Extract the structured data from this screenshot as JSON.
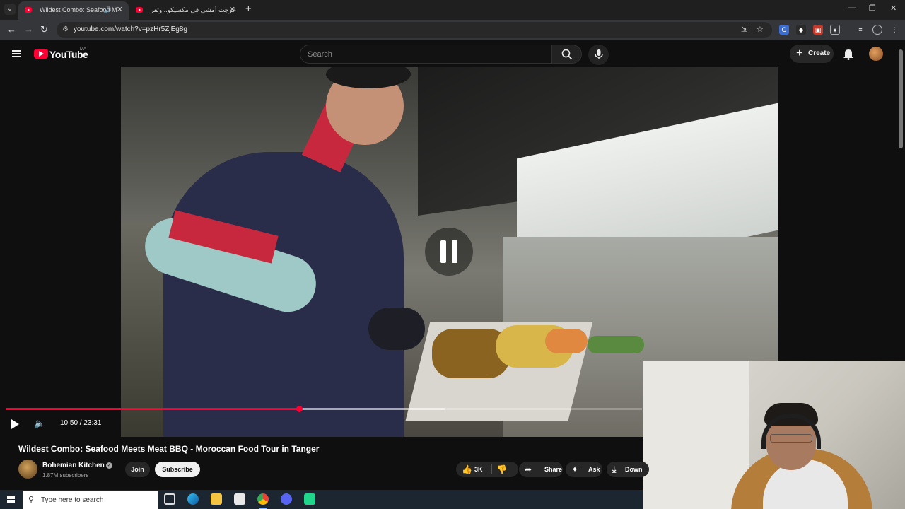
{
  "browser": {
    "tabs": [
      {
        "title": "Wildest Combo: Seafood M",
        "active": true,
        "audio": true
      },
      {
        "title": "خرجت أمشي في مكسيكو.. وتعر",
        "active": false
      }
    ],
    "new_tab_label": "+",
    "url": "youtube.com/watch?v=pzHr5ZjEg8g",
    "accent_color": "#ff0033"
  },
  "youtube": {
    "logo_text": "YouTube",
    "country_code": "MA",
    "search_placeholder": "Search",
    "create_label": "Create"
  },
  "player": {
    "current_time": "10:50",
    "duration": "23:31",
    "time_display": "10:50 / 23:31",
    "progress": 0.4606,
    "buffered": 0.69,
    "state": "paused-indicator"
  },
  "video": {
    "title": "Wildest Combo: Seafood Meets Meat BBQ - Moroccan Food Tour in Tanger",
    "channel_name": "Bohemian Kitchen",
    "subscribers": "1.87M subscribers",
    "join_label": "Join",
    "subscribe_label": "Subscribe",
    "likes": "3K",
    "share_label": "Share",
    "ask_label": "Ask",
    "download_label": "Down"
  },
  "taskbar": {
    "search_placeholder": "Type here to search",
    "apps": [
      "task-view",
      "edge",
      "file-explorer",
      "store",
      "chrome",
      "discord",
      "app-green"
    ]
  }
}
